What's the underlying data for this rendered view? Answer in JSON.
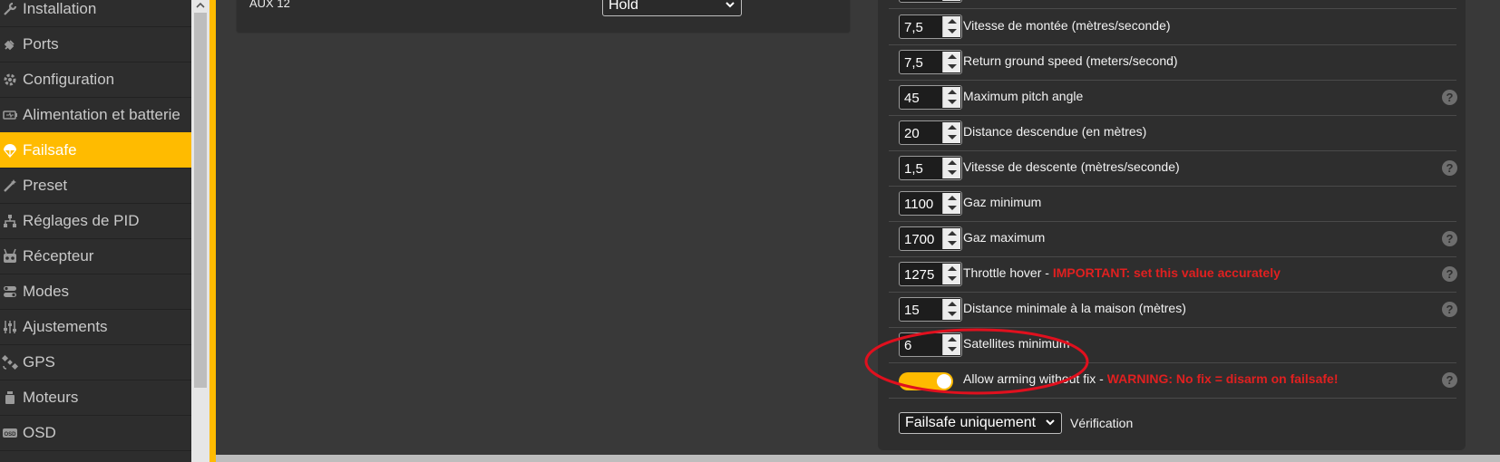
{
  "sidebar": {
    "items": [
      {
        "label": "Installation",
        "icon": "wrench-icon"
      },
      {
        "label": "Ports",
        "icon": "plug-icon"
      },
      {
        "label": "Configuration",
        "icon": "gear-icon"
      },
      {
        "label": "Alimentation et batterie",
        "icon": "battery-icon"
      },
      {
        "label": "Failsafe",
        "icon": "parachute-icon",
        "active": true
      },
      {
        "label": "Preset",
        "icon": "magic-wand-icon"
      },
      {
        "label": "Réglages de PID",
        "icon": "pid-tree-icon"
      },
      {
        "label": "Récepteur",
        "icon": "receiver-icon"
      },
      {
        "label": "Modes",
        "icon": "toggle-switches-icon"
      },
      {
        "label": "Ajustements",
        "icon": "sliders-icon"
      },
      {
        "label": "GPS",
        "icon": "satellite-icon"
      },
      {
        "label": "Moteurs",
        "icon": "motor-icon"
      },
      {
        "label": "OSD",
        "icon": "osd-icon"
      }
    ],
    "active_color": "#ffbb00"
  },
  "aux": {
    "label": "AUX 12",
    "select_value": "Hold"
  },
  "gps_rescue": {
    "rows": [
      {
        "value": "7,5",
        "label": "Vitesse de montée (mètres/seconde)",
        "help": false
      },
      {
        "value": "7,5",
        "label": "Return ground speed (meters/second)",
        "help": false
      },
      {
        "value": "45",
        "label": "Maximum pitch angle",
        "help": true
      },
      {
        "value": "20",
        "label": "Distance descendue (en mètres)",
        "help": false
      },
      {
        "value": "1,5",
        "label": "Vitesse de descente (mètres/seconde)",
        "help": true
      },
      {
        "value": "1100",
        "label": "Gaz minimum",
        "help": false
      },
      {
        "value": "1700",
        "label": "Gaz maximum",
        "help": true
      },
      {
        "value": "1275",
        "label": "Throttle hover - ",
        "warning": "IMPORTANT: set this value accurately",
        "help": true
      },
      {
        "value": "15",
        "label": "Distance minimale à la maison (mètres)",
        "help": true
      },
      {
        "value": "6",
        "label": "Satellites minimum",
        "help": false,
        "highlighted": true
      }
    ],
    "allow_arming": {
      "label": "Allow arming without fix - ",
      "warning": "WARNING: No fix = disarm on failsafe!",
      "enabled": true
    },
    "sanity_check": {
      "select_value": "Failsafe uniquement",
      "label": "Vérification"
    },
    "help_symbol": "?",
    "warning_color": "#e02020",
    "annotation_color": "#e0101e"
  }
}
